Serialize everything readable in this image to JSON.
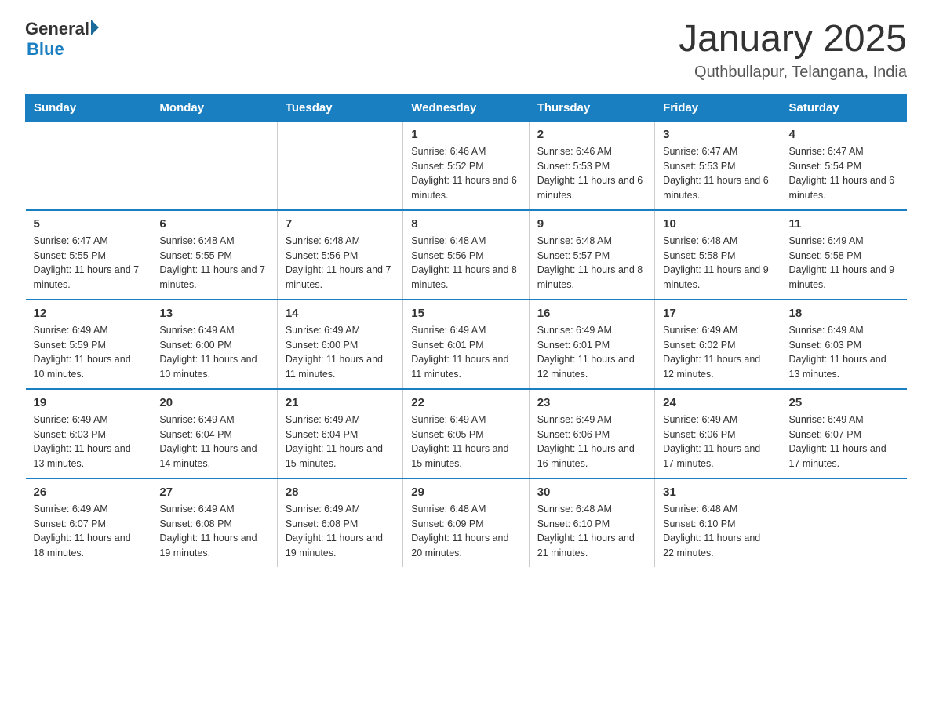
{
  "logo": {
    "text_general": "General",
    "text_blue": "Blue"
  },
  "title": {
    "main": "January 2025",
    "sub": "Quthbullapur, Telangana, India"
  },
  "headers": [
    "Sunday",
    "Monday",
    "Tuesday",
    "Wednesday",
    "Thursday",
    "Friday",
    "Saturday"
  ],
  "weeks": [
    [
      {
        "num": "",
        "info": ""
      },
      {
        "num": "",
        "info": ""
      },
      {
        "num": "",
        "info": ""
      },
      {
        "num": "1",
        "info": "Sunrise: 6:46 AM\nSunset: 5:52 PM\nDaylight: 11 hours and 6 minutes."
      },
      {
        "num": "2",
        "info": "Sunrise: 6:46 AM\nSunset: 5:53 PM\nDaylight: 11 hours and 6 minutes."
      },
      {
        "num": "3",
        "info": "Sunrise: 6:47 AM\nSunset: 5:53 PM\nDaylight: 11 hours and 6 minutes."
      },
      {
        "num": "4",
        "info": "Sunrise: 6:47 AM\nSunset: 5:54 PM\nDaylight: 11 hours and 6 minutes."
      }
    ],
    [
      {
        "num": "5",
        "info": "Sunrise: 6:47 AM\nSunset: 5:55 PM\nDaylight: 11 hours and 7 minutes."
      },
      {
        "num": "6",
        "info": "Sunrise: 6:48 AM\nSunset: 5:55 PM\nDaylight: 11 hours and 7 minutes."
      },
      {
        "num": "7",
        "info": "Sunrise: 6:48 AM\nSunset: 5:56 PM\nDaylight: 11 hours and 7 minutes."
      },
      {
        "num": "8",
        "info": "Sunrise: 6:48 AM\nSunset: 5:56 PM\nDaylight: 11 hours and 8 minutes."
      },
      {
        "num": "9",
        "info": "Sunrise: 6:48 AM\nSunset: 5:57 PM\nDaylight: 11 hours and 8 minutes."
      },
      {
        "num": "10",
        "info": "Sunrise: 6:48 AM\nSunset: 5:58 PM\nDaylight: 11 hours and 9 minutes."
      },
      {
        "num": "11",
        "info": "Sunrise: 6:49 AM\nSunset: 5:58 PM\nDaylight: 11 hours and 9 minutes."
      }
    ],
    [
      {
        "num": "12",
        "info": "Sunrise: 6:49 AM\nSunset: 5:59 PM\nDaylight: 11 hours and 10 minutes."
      },
      {
        "num": "13",
        "info": "Sunrise: 6:49 AM\nSunset: 6:00 PM\nDaylight: 11 hours and 10 minutes."
      },
      {
        "num": "14",
        "info": "Sunrise: 6:49 AM\nSunset: 6:00 PM\nDaylight: 11 hours and 11 minutes."
      },
      {
        "num": "15",
        "info": "Sunrise: 6:49 AM\nSunset: 6:01 PM\nDaylight: 11 hours and 11 minutes."
      },
      {
        "num": "16",
        "info": "Sunrise: 6:49 AM\nSunset: 6:01 PM\nDaylight: 11 hours and 12 minutes."
      },
      {
        "num": "17",
        "info": "Sunrise: 6:49 AM\nSunset: 6:02 PM\nDaylight: 11 hours and 12 minutes."
      },
      {
        "num": "18",
        "info": "Sunrise: 6:49 AM\nSunset: 6:03 PM\nDaylight: 11 hours and 13 minutes."
      }
    ],
    [
      {
        "num": "19",
        "info": "Sunrise: 6:49 AM\nSunset: 6:03 PM\nDaylight: 11 hours and 13 minutes."
      },
      {
        "num": "20",
        "info": "Sunrise: 6:49 AM\nSunset: 6:04 PM\nDaylight: 11 hours and 14 minutes."
      },
      {
        "num": "21",
        "info": "Sunrise: 6:49 AM\nSunset: 6:04 PM\nDaylight: 11 hours and 15 minutes."
      },
      {
        "num": "22",
        "info": "Sunrise: 6:49 AM\nSunset: 6:05 PM\nDaylight: 11 hours and 15 minutes."
      },
      {
        "num": "23",
        "info": "Sunrise: 6:49 AM\nSunset: 6:06 PM\nDaylight: 11 hours and 16 minutes."
      },
      {
        "num": "24",
        "info": "Sunrise: 6:49 AM\nSunset: 6:06 PM\nDaylight: 11 hours and 17 minutes."
      },
      {
        "num": "25",
        "info": "Sunrise: 6:49 AM\nSunset: 6:07 PM\nDaylight: 11 hours and 17 minutes."
      }
    ],
    [
      {
        "num": "26",
        "info": "Sunrise: 6:49 AM\nSunset: 6:07 PM\nDaylight: 11 hours and 18 minutes."
      },
      {
        "num": "27",
        "info": "Sunrise: 6:49 AM\nSunset: 6:08 PM\nDaylight: 11 hours and 19 minutes."
      },
      {
        "num": "28",
        "info": "Sunrise: 6:49 AM\nSunset: 6:08 PM\nDaylight: 11 hours and 19 minutes."
      },
      {
        "num": "29",
        "info": "Sunrise: 6:48 AM\nSunset: 6:09 PM\nDaylight: 11 hours and 20 minutes."
      },
      {
        "num": "30",
        "info": "Sunrise: 6:48 AM\nSunset: 6:10 PM\nDaylight: 11 hours and 21 minutes."
      },
      {
        "num": "31",
        "info": "Sunrise: 6:48 AM\nSunset: 6:10 PM\nDaylight: 11 hours and 22 minutes."
      },
      {
        "num": "",
        "info": ""
      }
    ]
  ]
}
